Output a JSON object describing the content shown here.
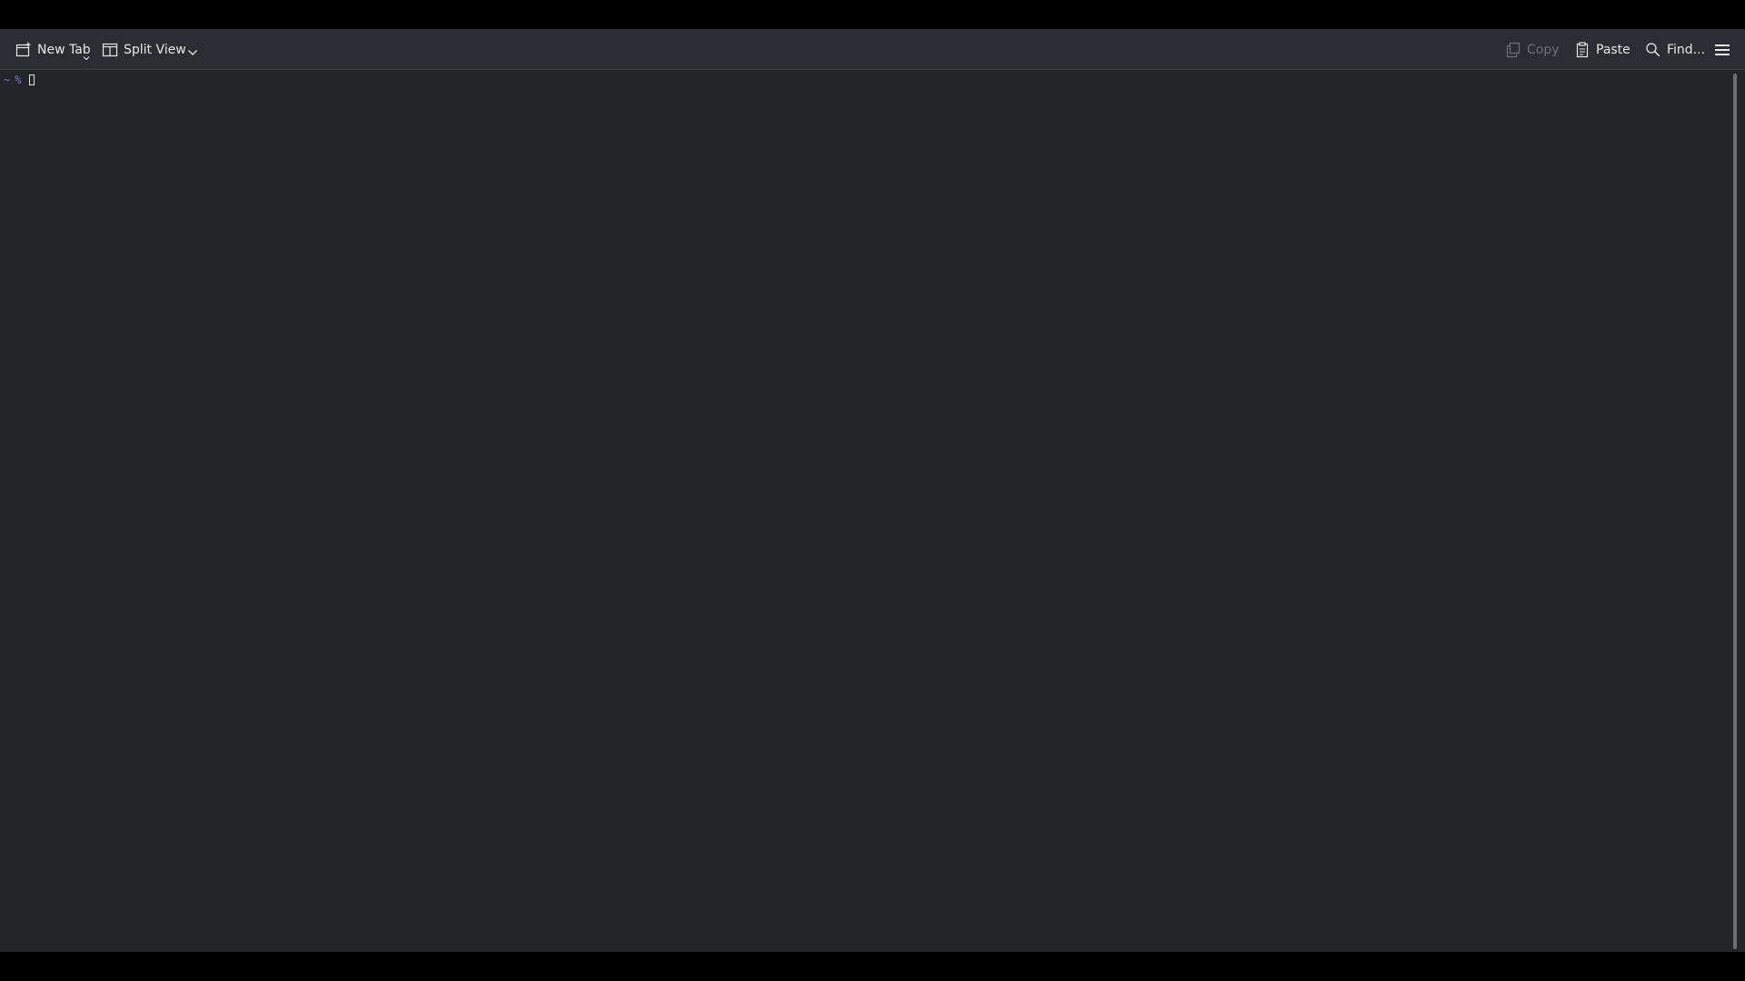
{
  "toolbar": {
    "new_tab_label": "New Tab",
    "split_view_label": "Split View",
    "copy_label": "Copy",
    "paste_label": "Paste",
    "find_label": "Find..."
  },
  "terminal": {
    "prompt_dir": "~",
    "prompt_symbol": "%"
  },
  "colors": {
    "background": "#232629",
    "toolbar": "#2a2e32",
    "prompt": "#8a6ad6",
    "text": "#e8e8e8",
    "disabled_text": "#6c7074"
  },
  "icons": {
    "new_tab": "new-tab-icon",
    "split_view": "split-view-icon",
    "copy": "copy-icon",
    "paste": "paste-icon",
    "find": "search-icon",
    "menu": "hamburger-menu-icon"
  }
}
